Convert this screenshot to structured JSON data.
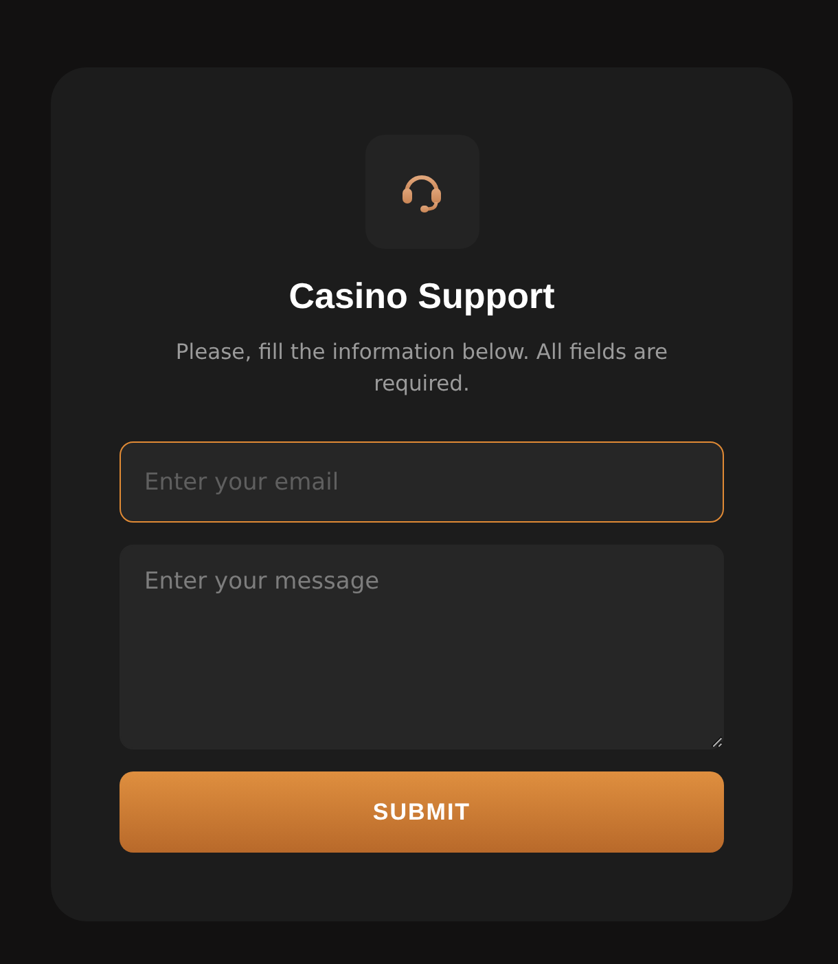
{
  "title": "Casino Support",
  "subtitle": "Please, fill the information below. All fields are required.",
  "fields": [
    {
      "kind": "input",
      "placeholder": "Enter your email",
      "focused": true
    },
    {
      "kind": "textarea",
      "placeholder": "Enter your message",
      "focused": false
    }
  ],
  "submit_button": "SUBMIT"
}
